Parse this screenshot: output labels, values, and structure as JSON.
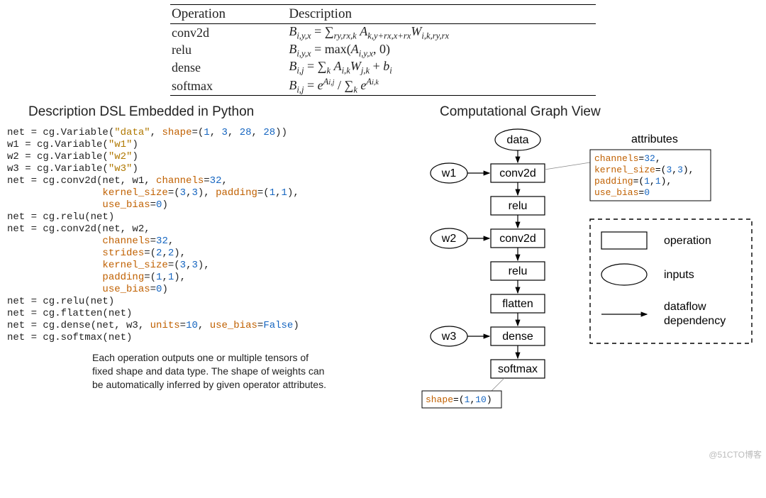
{
  "table": {
    "headers": [
      "Operation",
      "Description"
    ],
    "rows": [
      {
        "op": "conv2d",
        "desc_html": "<span class='math'>B</span><span class='sub'>i,y,x</span> = <span class='op'>&#8721;</span><span class='sub'>ry,rx,k</span> <span class='math'>A</span><span class='sub'>k,y+rx,x+rx</span><span class='math'>W</span><span class='sub'>i,k,ry,rx</span>"
      },
      {
        "op": "relu",
        "desc_html": "<span class='math'>B</span><span class='sub'>i,y,x</span> = <span class='rm'>max</span>(<span class='math'>A</span><span class='sub'>i,y,x</span>, 0)"
      },
      {
        "op": "dense",
        "desc_html": "<span class='math'>B</span><span class='sub'>i,j</span> = <span class='op'>&#8721;</span><span class='sub'>k</span> <span class='math'>A</span><span class='sub'>i,k</span><span class='math'>W</span><span class='sub'>j,k</span> + <span class='math'>b</span><span class='sub'>i</span>"
      },
      {
        "op": "softmax",
        "desc_html": "<span class='math'>B</span><span class='sub'>i,j</span> = <span class='math'>e</span><span class='sup'>A<span style='font-size:0.8em'>i,j</span></span> / <span class='op'>&#8721;</span><span class='sub'>k</span> <span class='math'>e</span><span class='sup'>A<span style='font-size:0.8em'>i,k</span></span>"
      }
    ]
  },
  "left_panel": {
    "title": "Description DSL Embedded in Python",
    "code_html": "net = cg.Variable(<span class='kw-str'>\"data\"</span>, <span class='kw-orange'>shape</span>=(<span class='kw-num'>1</span>, <span class='kw-num'>3</span>, <span class='kw-num'>28</span>, <span class='kw-num'>28</span>))\nw1 = cg.Variable(<span class='kw-str'>\"w1\"</span>)\nw2 = cg.Variable(<span class='kw-str'>\"w2\"</span>)\nw3 = cg.Variable(<span class='kw-str'>\"w3\"</span>)\nnet = cg.conv2d(net, w1, <span class='kw-orange'>channels</span>=<span class='kw-num'>32</span>,\n                <span class='kw-orange'>kernel_size</span>=(<span class='kw-num'>3</span>,<span class='kw-num'>3</span>), <span class='kw-orange'>padding</span>=(<span class='kw-num'>1</span>,<span class='kw-num'>1</span>),\n                <span class='kw-orange'>use_bias</span>=<span class='kw-num'>0</span>)\nnet = cg.relu(net)\nnet = cg.conv2d(net, w2,\n                <span class='kw-orange'>channels</span>=<span class='kw-num'>32</span>,\n                <span class='kw-orange'>strides</span>=(<span class='kw-num'>2</span>,<span class='kw-num'>2</span>),\n                <span class='kw-orange'>kernel_size</span>=(<span class='kw-num'>3</span>,<span class='kw-num'>3</span>),\n                <span class='kw-orange'>padding</span>=(<span class='kw-num'>1</span>,<span class='kw-num'>1</span>),\n                <span class='kw-orange'>use_bias</span>=<span class='kw-num'>0</span>)\nnet = cg.relu(net)\nnet = cg.flatten(net)\nnet = cg.dense(net, w3, <span class='kw-orange'>units</span>=<span class='kw-num'>10</span>, <span class='kw-orange'>use_bias</span>=<span class='kw-bool'>False</span>)\nnet = cg.softmax(net)",
    "caption": "Each operation outputs one or multiple tensors of fixed shape and data type. The shape of weights can be automatically inferred by given operator attributes."
  },
  "right_panel": {
    "title": "Computational Graph View",
    "attributes_label": "attributes",
    "attr_lines": [
      [
        {
          "t": "channels",
          "c": "#c06000"
        },
        {
          "t": "=",
          "c": "#000"
        },
        {
          "t": "32",
          "c": "#1565c0"
        },
        {
          "t": ",",
          "c": "#000"
        }
      ],
      [
        {
          "t": "kernel_size",
          "c": "#c06000"
        },
        {
          "t": "=(",
          "c": "#000"
        },
        {
          "t": "3",
          "c": "#1565c0"
        },
        {
          "t": ",",
          "c": "#000"
        },
        {
          "t": "3",
          "c": "#1565c0"
        },
        {
          "t": "),",
          "c": "#000"
        }
      ],
      [
        {
          "t": "padding",
          "c": "#c06000"
        },
        {
          "t": "=(",
          "c": "#000"
        },
        {
          "t": "1",
          "c": "#1565c0"
        },
        {
          "t": ",",
          "c": "#000"
        },
        {
          "t": "1",
          "c": "#1565c0"
        },
        {
          "t": "),",
          "c": "#000"
        }
      ],
      [
        {
          "t": "use_bias",
          "c": "#c06000"
        },
        {
          "t": "=",
          "c": "#000"
        },
        {
          "t": "0",
          "c": "#1565c0"
        }
      ]
    ],
    "shape_line": [
      {
        "t": "shape",
        "c": "#c06000"
      },
      {
        "t": "=(",
        "c": "#000"
      },
      {
        "t": "1",
        "c": "#1565c0"
      },
      {
        "t": ",",
        "c": "#000"
      },
      {
        "t": "10",
        "c": "#1565c0"
      },
      {
        "t": ")",
        "c": "#000"
      }
    ],
    "nodes": {
      "data": "data",
      "w1": "w1",
      "w2": "w2",
      "w3": "w3",
      "conv1": "conv2d",
      "relu1": "relu",
      "conv2": "conv2d",
      "relu2": "relu",
      "flat": "flatten",
      "dense": "dense",
      "soft": "softmax"
    },
    "legend": {
      "operation": "operation",
      "inputs": "inputs",
      "dep1": "dataflow",
      "dep2": "dependency"
    }
  },
  "watermark": "@51CTO博客"
}
